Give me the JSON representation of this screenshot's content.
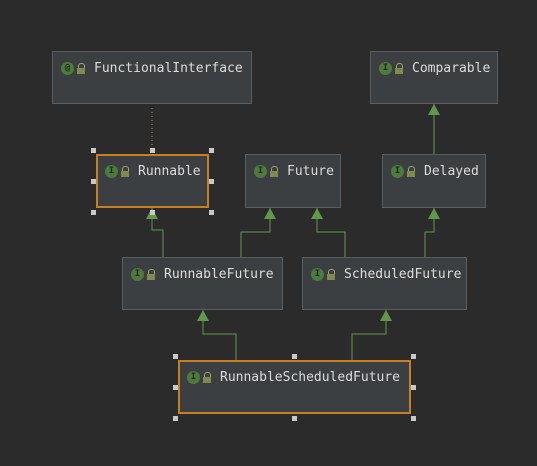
{
  "diagram": {
    "nodes": [
      {
        "id": "functional-interface",
        "label": "FunctionalInterface",
        "kind": "@",
        "kind_name": "annotation-icon"
      },
      {
        "id": "comparable",
        "label": "Comparable",
        "kind": "I",
        "kind_name": "interface-icon"
      },
      {
        "id": "runnable",
        "label": "Runnable",
        "kind": "I",
        "kind_name": "interface-icon",
        "selected": true
      },
      {
        "id": "future",
        "label": "Future",
        "kind": "I",
        "kind_name": "interface-icon"
      },
      {
        "id": "delayed",
        "label": "Delayed",
        "kind": "I",
        "kind_name": "interface-icon"
      },
      {
        "id": "runnable-future",
        "label": "RunnableFuture",
        "kind": "I",
        "kind_name": "interface-icon"
      },
      {
        "id": "scheduled-future",
        "label": "ScheduledFuture",
        "kind": "I",
        "kind_name": "interface-icon"
      },
      {
        "id": "runnable-scheduled-future",
        "label": "RunnableScheduledFuture",
        "kind": "I",
        "kind_name": "interface-icon",
        "selected": true
      }
    ],
    "edges": [
      {
        "from": "runnable",
        "to": "functional-interface",
        "style": "dotted"
      },
      {
        "from": "delayed",
        "to": "comparable",
        "style": "extends"
      },
      {
        "from": "runnable-future",
        "to": "runnable",
        "style": "extends"
      },
      {
        "from": "runnable-future",
        "to": "future",
        "style": "extends"
      },
      {
        "from": "scheduled-future",
        "to": "future",
        "style": "extends"
      },
      {
        "from": "scheduled-future",
        "to": "delayed",
        "style": "extends"
      },
      {
        "from": "runnable-scheduled-future",
        "to": "runnable-future",
        "style": "extends"
      },
      {
        "from": "runnable-scheduled-future",
        "to": "scheduled-future",
        "style": "extends"
      }
    ],
    "colors": {
      "background": "#2b2b2b",
      "node_fill": "#3c3f41",
      "node_border": "#5a5d60",
      "selected_border": "#c8801f",
      "edge": "#5f9a4a",
      "dotted_edge": "#b09050",
      "text": "#dcdcdc"
    }
  }
}
